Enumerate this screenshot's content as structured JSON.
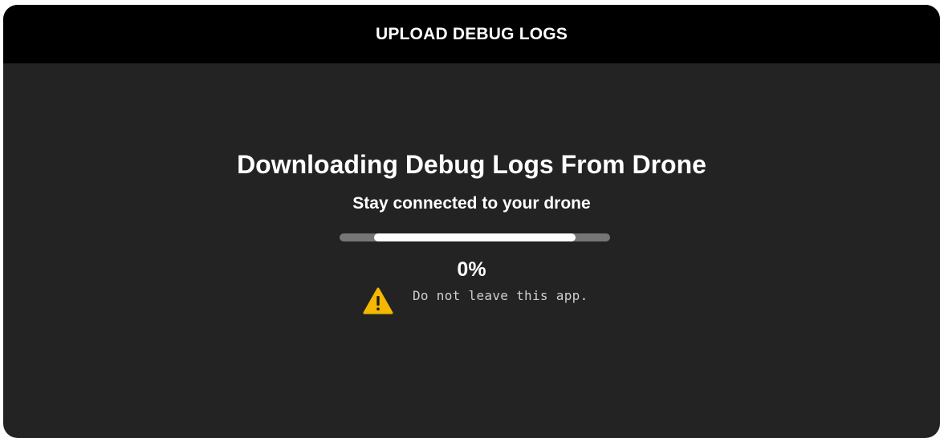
{
  "header": {
    "title": "UPLOAD DEBUG LOGS"
  },
  "main": {
    "title": "Downloading Debug Logs From Drone",
    "subtitle": "Stay connected to your drone",
    "progress_percent_label": "0%",
    "progress_bar_fill_fraction": 0.74,
    "warning": {
      "icon": "warning-triangle-icon",
      "text": "Do not leave this app."
    }
  },
  "colors": {
    "dialog_background": "#232323",
    "header_background": "#000000",
    "text_primary": "#ffffff",
    "progress_track": "#767676",
    "progress_fill": "#ffffff",
    "warning_icon": "#f5b800"
  }
}
